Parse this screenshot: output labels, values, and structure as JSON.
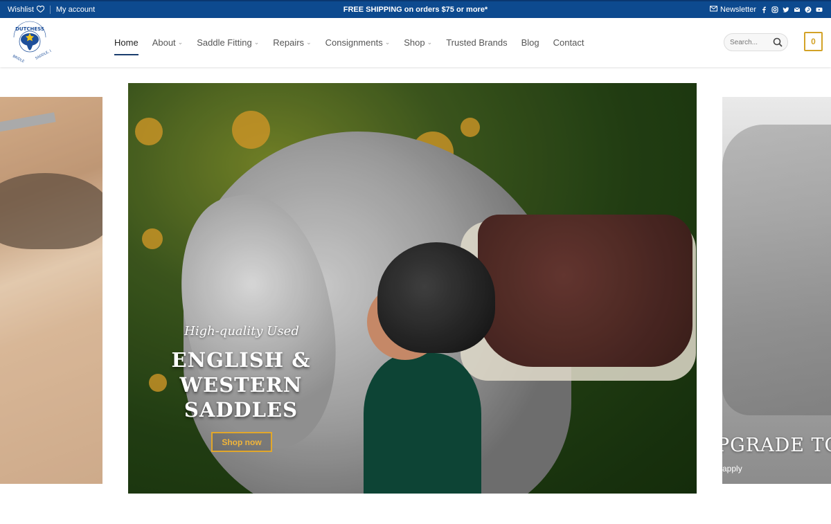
{
  "topbar": {
    "wishlist": "Wishlist",
    "account": "My account",
    "promo": "FREE SHIPPING on orders $75 or more*",
    "newsletter": "Newsletter",
    "social_icons": [
      "facebook-icon",
      "instagram-icon",
      "twitter-icon",
      "email-icon",
      "pinterest-icon",
      "youtube-icon"
    ]
  },
  "header": {
    "logo_alt": "DUTCHESS BRIDLE & SADDLE, LLC",
    "nav": [
      {
        "label": "Home",
        "active": true,
        "has_dropdown": false
      },
      {
        "label": "About",
        "has_dropdown": true
      },
      {
        "label": "Saddle Fitting",
        "has_dropdown": true
      },
      {
        "label": "Repairs",
        "has_dropdown": true
      },
      {
        "label": "Consignments",
        "has_dropdown": true
      },
      {
        "label": "Shop",
        "has_dropdown": true
      },
      {
        "label": "Trusted Brands",
        "has_dropdown": false
      },
      {
        "label": "Blog",
        "has_dropdown": false
      },
      {
        "label": "Contact",
        "has_dropdown": false
      }
    ],
    "search_placeholder": "Search...",
    "cart_count": "0"
  },
  "hero": {
    "eyebrow": "High-quality Used",
    "headline": "ENGLISH & WESTERN SADDLES",
    "cta": "Shop now"
  },
  "next_slide": {
    "caption": "PGRADE TO",
    "sub": "apply"
  },
  "colors": {
    "topbar": "#0d4a8f",
    "accent": "#d3a226",
    "nav_active_underline": "#1a3d6e"
  }
}
